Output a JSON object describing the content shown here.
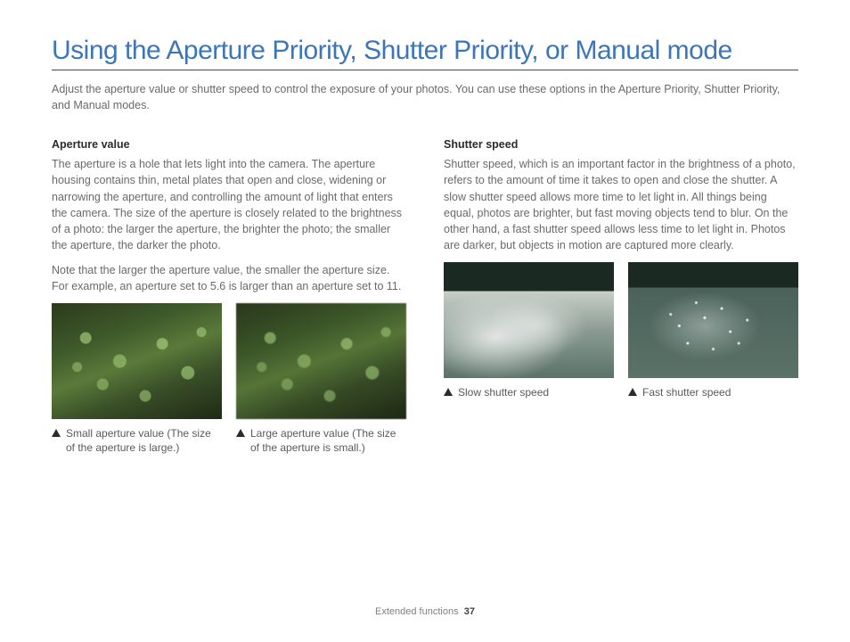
{
  "title": "Using the Aperture Priority, Shutter Priority, or Manual mode",
  "intro": "Adjust the aperture value or shutter speed to control the exposure of your photos. You can use these options in the Aperture Priority, Shutter Priority, and Manual modes.",
  "left": {
    "heading": "Aperture value",
    "para1": "The aperture is a hole that lets light into the camera. The aperture housing contains thin, metal plates that open and close, widening or narrowing the aperture, and controlling the amount of light that enters the camera. The size of the aperture is closely related to the brightness of a photo: the larger the aperture, the brighter the photo; the smaller the aperture, the darker the photo.",
    "para2": "Note that the larger the aperture value, the smaller the aperture size. For example, an aperture set to 5.6 is larger than an aperture set to 11.",
    "caption1": "Small aperture value (The size of the aperture is large.)",
    "caption2": "Large aperture value (The size of the aperture is small.)"
  },
  "right": {
    "heading": "Shutter speed",
    "para1": "Shutter speed, which is an important factor in the brightness of a photo, refers to the amount of time it takes to open and close the shutter. A slow shutter speed allows more time to let light in. All things being equal, photos are brighter, but fast moving objects tend to blur. On the other hand, a fast shutter speed allows less time to let light in. Photos are darker, but objects in motion are captured more clearly.",
    "caption1": "Slow shutter speed",
    "caption2": "Fast shutter speed"
  },
  "footer": {
    "section": "Extended functions",
    "page": "37"
  }
}
